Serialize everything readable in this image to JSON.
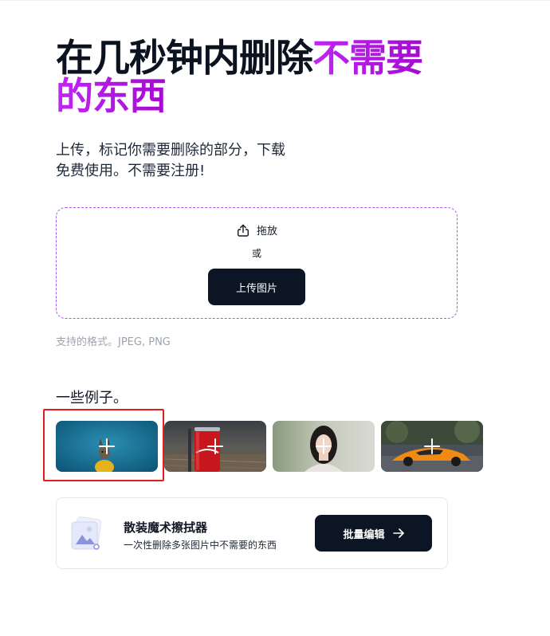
{
  "hero": {
    "title_part1": "在几秒钟内删除",
    "title_accent_1": "不需要",
    "title_accent_2": "的东西",
    "subtitle_line1": "上传，标记你需要删除的部分，下载",
    "subtitle_line2": "免费使用。不需要注册!"
  },
  "upload": {
    "drag_label": "拖放",
    "or_label": "或",
    "button_label": "上传图片",
    "icon": "upload-icon",
    "formats_text": "支持的格式。JPEG, PNG"
  },
  "examples": {
    "label": "一些例子。",
    "items": [
      {
        "subject": "dog in yellow sweater",
        "selected": true
      },
      {
        "subject": "cola can on table",
        "selected": false
      },
      {
        "subject": "woman portrait",
        "selected": false
      },
      {
        "subject": "orange sports car",
        "selected": false
      }
    ]
  },
  "bulk": {
    "title": "散装魔术擦拭器",
    "description": "一次性删除多张图片中不需要的东西",
    "button_label": "批量编辑",
    "button_icon": "arrow-right-icon",
    "icon": "images-stack-icon"
  },
  "colors": {
    "accent": "#b31ae0",
    "button_bg": "#0b1524",
    "dropzone_border": "#a855f7",
    "highlight": "#e11d1d"
  }
}
